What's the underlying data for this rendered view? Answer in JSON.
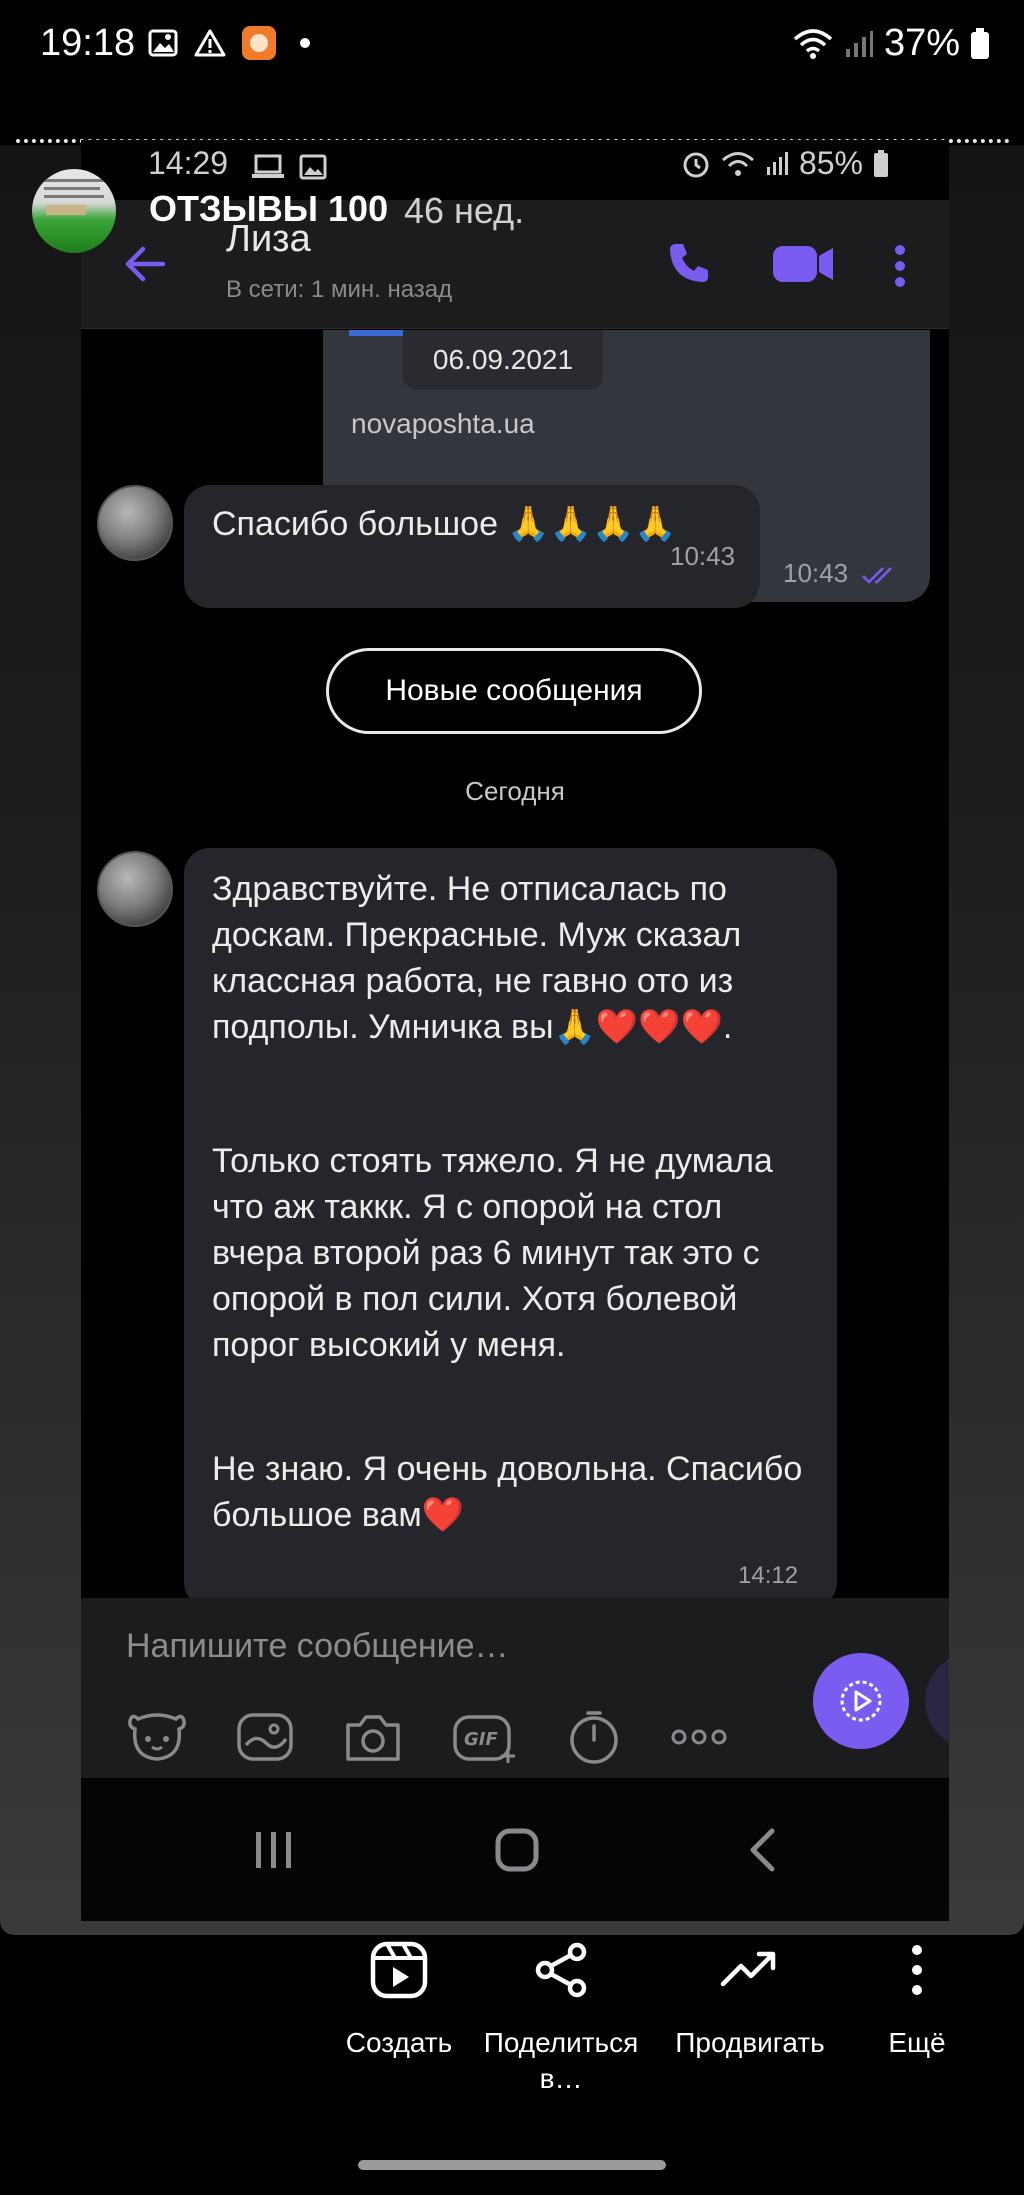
{
  "status_bar": {
    "time": "19:18",
    "battery": "37%"
  },
  "story_header": {
    "account_name": "ОТЗЫВЫ 100",
    "age": "46 нед."
  },
  "inner_status": {
    "time": "14:29",
    "battery": "85%"
  },
  "chat_header": {
    "contact_name": "Лиза",
    "contact_status": "В сети: 1 мин. назад"
  },
  "messages": {
    "outgoing_partial": {
      "date": "06.09.2021",
      "link": "novaposhta.ua",
      "time": "10:43"
    },
    "incoming_1": {
      "text": "Спасибо большое 🙏🙏🙏🙏",
      "time": "10:43"
    },
    "new_messages_label": "Новые сообщения",
    "today_label": "Сегодня",
    "incoming_2": {
      "paragraph_1": "Здравствуйте. Не отписалась по доскам. Прекрасные. Муж сказал классная работа, не гавно ото из подполы. Умничка вы🙏❤️❤️❤️.",
      "paragraph_2": "Только стоять тяжело. Я не думала что аж таккк. Я с опорой на стол вчера второй раз 6 минут так это с опорой в пол сили. Хотя болевой порог высокий у меня.",
      "paragraph_3": "Не знаю. Я очень довольна. Спасибо большое вам❤️",
      "time": "14:12"
    }
  },
  "composer": {
    "placeholder": "Напишите сообщение…"
  },
  "actions": {
    "create": "Создать",
    "share": "Поделиться в…",
    "promote": "Продвигать",
    "more": "Ещё"
  },
  "colors": {
    "accent": "#7b5cf0",
    "bubble": "#25262b",
    "header": "#1c1c1f"
  }
}
